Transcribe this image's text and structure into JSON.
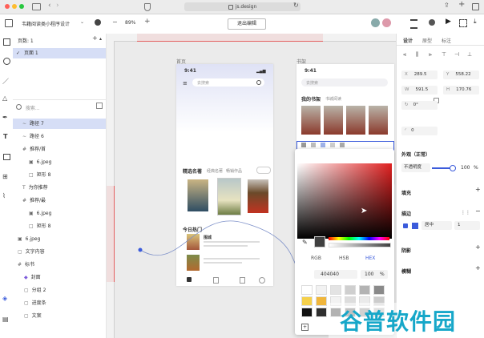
{
  "browser": {
    "url": "js.design"
  },
  "toolbar": {
    "doc_title": "韦籍阅读类小程序设计",
    "zoom": "89%",
    "exit_label": "退出编辑"
  },
  "pages": {
    "header": "页数: 1",
    "current": "页面 1"
  },
  "layers": {
    "search_placeholder": "搜索...",
    "items": [
      "路径 7",
      "路径 6",
      "推荐/首",
      "6.jpeg",
      "矩形 8",
      "为你推荐",
      "推荐/最",
      "6.jpeg",
      "矩形 8",
      "6.jpeg",
      "文字内容",
      "标书",
      "封面",
      "分组 2",
      "进度条",
      "文案"
    ]
  },
  "canvas": {
    "home_label": "首页",
    "shelf_label": "书架",
    "status_time": "9:41",
    "search_ph": "去搜索",
    "sections": [
      "精选名著",
      "经典名著",
      "畅销作品"
    ],
    "today": "今日热门",
    "book_title": "围城",
    "shelf_tabs": [
      "我的书架",
      "书城阅读"
    ]
  },
  "picker": {
    "tabs": [
      "RGB",
      "HSB",
      "HEX"
    ],
    "hex": "404040",
    "opacity": "100",
    "opacity_unit": "%"
  },
  "rpanel": {
    "tabs": [
      "设计",
      "原型",
      "标注"
    ],
    "x_label": "X",
    "x": "289.5",
    "y_label": "Y",
    "y": "558.22",
    "w_label": "W",
    "w": "591.5",
    "h_label": "H",
    "h": "170.76",
    "rotate": "0°",
    "corner": "0",
    "appearance": "外观（正常）",
    "opacity_label": "不透明度",
    "opacity": "100",
    "opacity_unit": "%",
    "fill": "填充",
    "stroke": "描边",
    "stroke_align": "居中",
    "stroke_width": "1",
    "shadow": "阴影",
    "blur": "模糊"
  },
  "watermark": "谷普软件园",
  "colors": {
    "accent": "#3b5bdb",
    "selected_row": "#d6def6",
    "picker_red": "#e02020"
  }
}
